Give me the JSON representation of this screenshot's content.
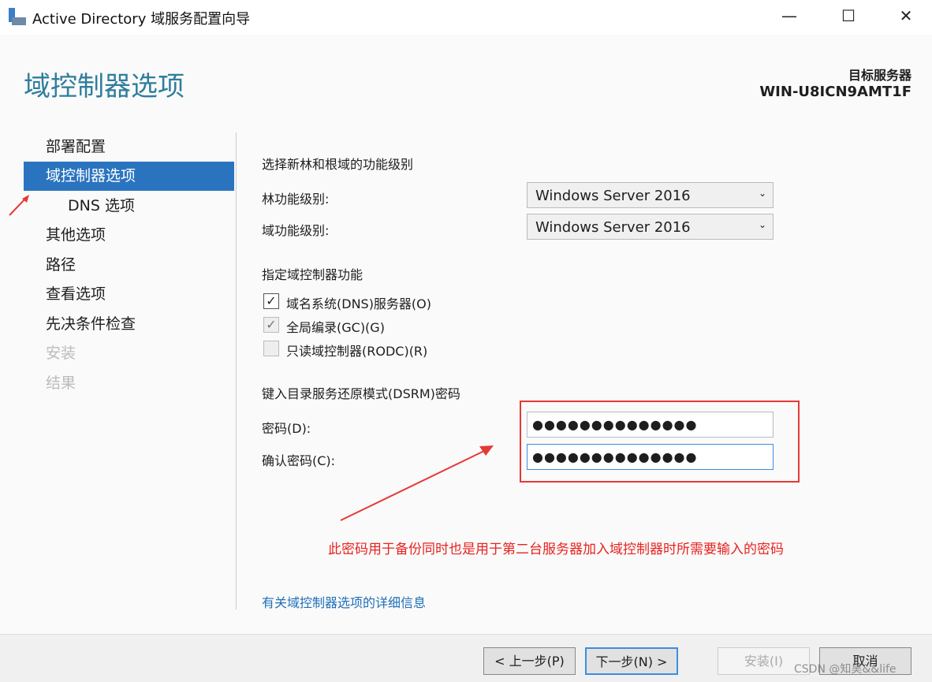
{
  "window": {
    "title": "Active Directory 域服务配置向导",
    "minimize": "—",
    "maximize": "☐",
    "close": "✕"
  },
  "header": {
    "title": "域控制器选项",
    "target_label": "目标服务器",
    "target_server": "WIN-U8ICN9AMT1F"
  },
  "nav": [
    {
      "label": "部署配置"
    },
    {
      "label": "域控制器选项"
    },
    {
      "label": "DNS 选项"
    },
    {
      "label": "其他选项"
    },
    {
      "label": "路径"
    },
    {
      "label": "查看选项"
    },
    {
      "label": "先决条件检查"
    },
    {
      "label": "安装"
    },
    {
      "label": "结果"
    }
  ],
  "levels": {
    "heading": "选择新林和根域的功能级别",
    "forest_label": "林功能级别:",
    "forest_value": "Windows Server 2016",
    "domain_label": "域功能级别:",
    "domain_value": "Windows Server 2016"
  },
  "capabilities": {
    "heading": "指定域控制器功能",
    "items": [
      {
        "label": "域名系统(DNS)服务器(O)",
        "checked": true,
        "enabled": true
      },
      {
        "label": "全局编录(GC)(G)",
        "checked": true,
        "enabled": false
      },
      {
        "label": "只读域控制器(RODC)(R)",
        "checked": false,
        "enabled": false
      }
    ]
  },
  "dsrm": {
    "heading": "键入目录服务还原模式(DSRM)密码",
    "password_label": "密码(D):",
    "password_value": "●●●●●●●●●●●●●●",
    "confirm_label": "确认密码(C):",
    "confirm_value": "●●●●●●●●●●●●●●"
  },
  "annotation": "此密码用于备份同时也是用于第二台服务器加入域控制器时所需要输入的密码",
  "link": "有关域控制器选项的详细信息",
  "footer": {
    "prev": "< 上一步(P)",
    "next": "下一步(N) >",
    "install": "安装(I)",
    "cancel": "取消"
  },
  "watermark": "CSDN @知昊&&life",
  "colors": {
    "accent": "#2a74bf",
    "annotation": "#e53935"
  }
}
